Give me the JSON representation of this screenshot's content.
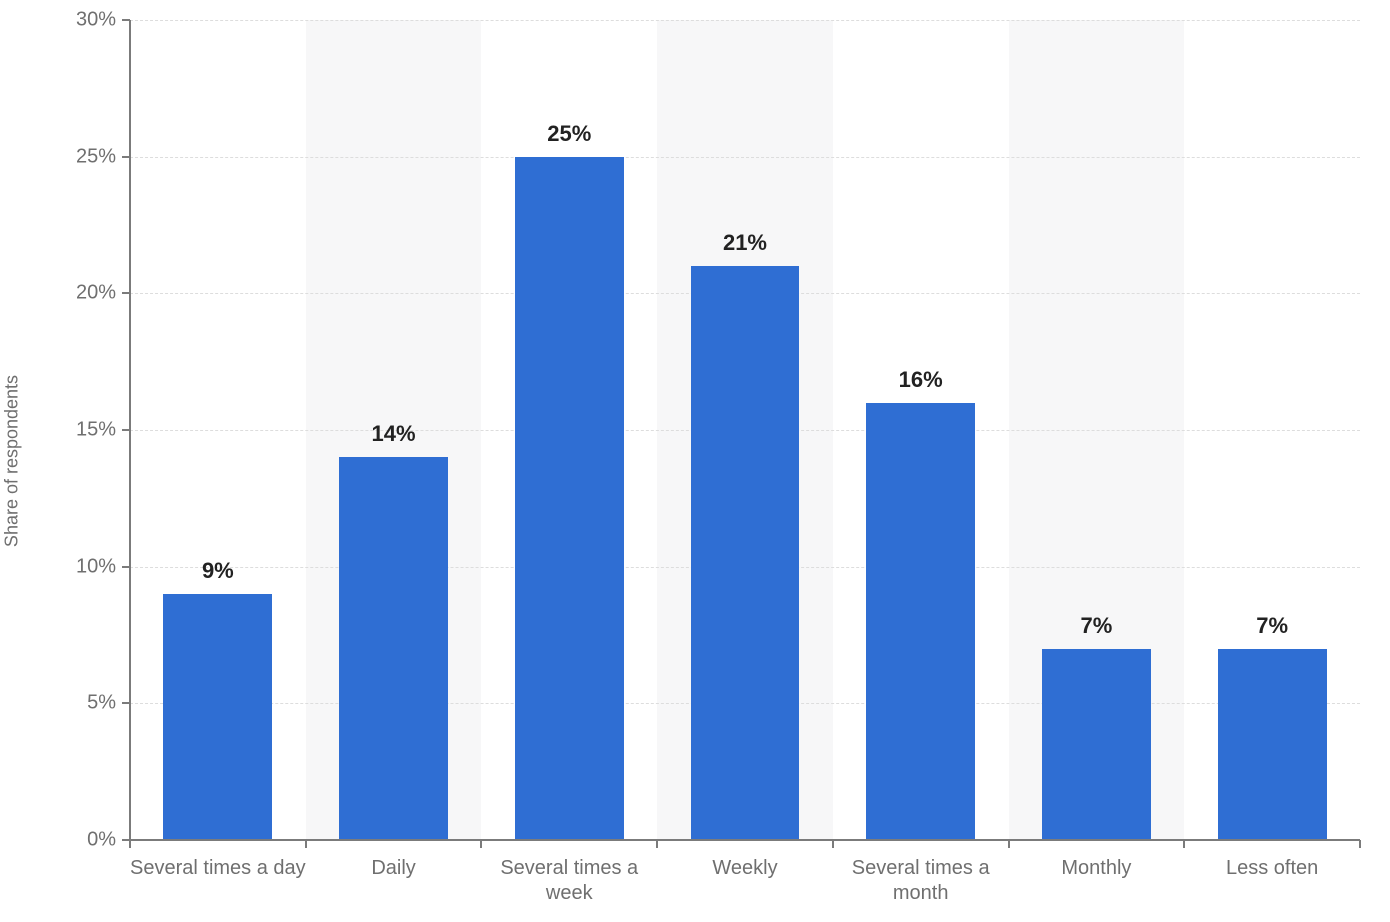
{
  "chart_data": {
    "type": "bar",
    "categories": [
      "Several times a day",
      "Daily",
      "Several times a week",
      "Weekly",
      "Several times a month",
      "Monthly",
      "Less often"
    ],
    "values": [
      9,
      14,
      25,
      21,
      16,
      7,
      7
    ],
    "value_labels": [
      "9%",
      "14%",
      "25%",
      "21%",
      "16%",
      "7%",
      "7%"
    ],
    "ylabel": "Share of respondents",
    "xlabel": "",
    "title": "",
    "ylim": [
      0,
      30
    ],
    "yticks": [
      0,
      5,
      10,
      15,
      20,
      25,
      30
    ],
    "ytick_labels": [
      "0%",
      "5%",
      "10%",
      "15%",
      "20%",
      "25%",
      "30%"
    ],
    "bar_color": "#2f6ed3"
  }
}
